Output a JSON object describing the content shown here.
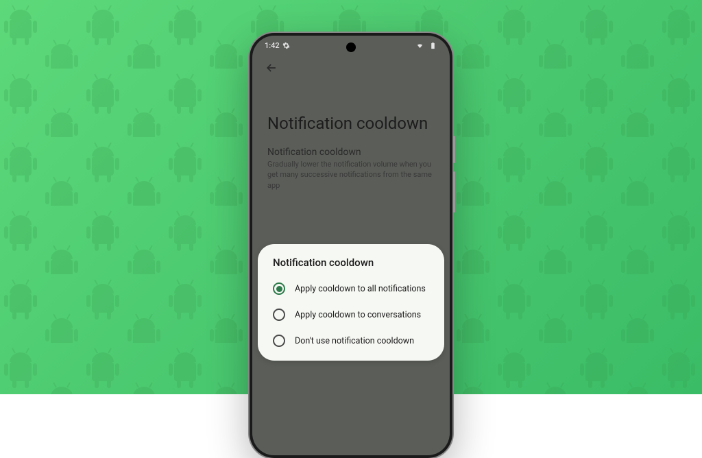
{
  "statusBar": {
    "time": "1:42"
  },
  "page": {
    "title": "Notification cooldown",
    "subtitle": "Notification cooldown",
    "description": "Gradually lower the notification volume when you get many successive notifications from the same app"
  },
  "dialog": {
    "title": "Notification cooldown",
    "options": [
      {
        "label": "Apply cooldown to all notifications",
        "selected": true
      },
      {
        "label": "Apply cooldown to conversations",
        "selected": false
      },
      {
        "label": "Don't use notification cooldown",
        "selected": false
      }
    ]
  }
}
